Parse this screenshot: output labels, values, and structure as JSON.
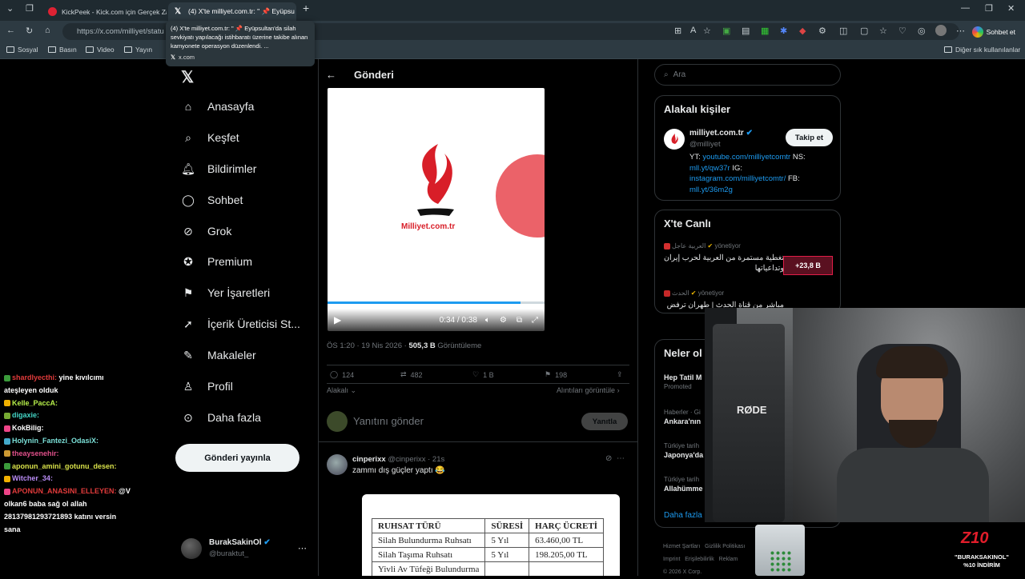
{
  "browser": {
    "tabs": [
      {
        "title": "KickPeek - Kick.com için Gerçek Za"
      },
      {
        "title": "(4) X'te milliyet.com.tr: \" 📌 Eyüpsu"
      }
    ],
    "url": "https://x.com/milliyet/statu",
    "sohbet_label": "Sohbet et",
    "bookmarks": [
      "Sosyal",
      "Basın",
      "Video",
      "Yayın"
    ],
    "other_bookmarks": "Diğer sık kullanılanlar"
  },
  "tooltip": {
    "text": "(4) X'te milliyet.com.tr: \" 📌 Eyüpsultan'da silah sevkiyatı yapılacağı istihbaratı üzerine takibe alınan kamyonete operasyon düzenlendi. ...",
    "domain": "x.com"
  },
  "chat": [
    {
      "user": "shardlyecthi:",
      "msg": "yine kıvılcımı",
      "color": "#e23b3b"
    },
    {
      "user": "",
      "msg": "ateşleyen olduk",
      "color": "#ffffff"
    },
    {
      "user": "Kelle_PaccA:",
      "msg": "",
      "color": "#b7f04a"
    },
    {
      "user": "digaxie:",
      "msg": "",
      "color": "#44d6c6"
    },
    {
      "user": "KokBilig:",
      "msg": "",
      "color": "#ffffff"
    },
    {
      "user": "Holynin_Fantezi_OdasiX:",
      "msg": "",
      "color": "#7be0d8"
    },
    {
      "user": "theaysenehir:",
      "msg": "",
      "color": "#e0508a"
    },
    {
      "user": "aponun_amini_gotunu_desen:",
      "msg": "",
      "color": "#d9e24a"
    },
    {
      "user": "",
      "msg": "",
      "color": "#ffffff"
    },
    {
      "user": "Witcher_34:",
      "msg": "",
      "color": "#b98cf5"
    },
    {
      "user": "",
      "msg": "",
      "color": "#ffffff"
    },
    {
      "user": "APONUN_ANASINI_ELLEYEN:",
      "msg": "@V",
      "color": "#e23b3b"
    },
    {
      "user": "",
      "msg": "olkan6 baba sağ ol allah",
      "color": "#ffffff"
    },
    {
      "user": "",
      "msg": "2813798129372189​3 katını versin",
      "color": "#ffffff"
    },
    {
      "user": "",
      "msg": "sana",
      "color": "#ffffff"
    }
  ],
  "nav": {
    "items": [
      "Anasayfa",
      "Keşfet",
      "Bildirimler",
      "Sohbet",
      "Grok",
      "Premium",
      "Yer İşaretleri",
      "İçerik Üreticisi St...",
      "Makaleler",
      "Profil",
      "Daha fazla"
    ],
    "post_button": "Gönderi yayınla",
    "account_name": "BurakSakinOl",
    "account_handle": "@buraktut_"
  },
  "post": {
    "header": "Gönderi",
    "video_logo_text": "Milliyet.com.tr",
    "video_time": "0:34 / 0:38",
    "video_progress": 0.89,
    "timestamp": "ÖS 1:20 · 19 Nis 2026 · ",
    "views": "505,3 B",
    "views_label": "Görüntüleme",
    "replies": "124",
    "reposts": "482",
    "likes": "1 B",
    "bookmarks": "198",
    "related_label": "Alakalı",
    "quotes_label": "Alıntıları görüntüle",
    "reply_placeholder": "Yanıtını gönder",
    "reply_button": "Yanıtla"
  },
  "reply_tweet": {
    "name": "cinperixx",
    "handle": "@cinperixx · 21s",
    "text": "zammı dış güçler yaptı 😂",
    "table_headers": [
      "RUHSAT TÜRÜ",
      "SÜRESİ",
      "HARÇ ÜCRETİ"
    ],
    "table_rows": [
      [
        "Silah Bulundurma Ruhsatı",
        "5 Yıl",
        "63.460,00 TL"
      ],
      [
        "Silah Taşıma Ruhsatı",
        "5 Yıl",
        "198.205,00 TL"
      ],
      [
        "Yivli Av Tüfeği Bulundurma",
        "",
        ""
      ]
    ]
  },
  "right": {
    "search_placeholder": "Ara",
    "related_title": "Alakalı kişiler",
    "related_name": "milliyet.com.tr",
    "related_handle": "@milliyet",
    "follow_button": "Takip et",
    "bio_yt_label": "YT:",
    "bio_yt": "youtube.com/milliyetcomtr",
    "bio_ns_label": "NS:",
    "bio_ns": "mll.yt/qw37r",
    "bio_ig_label": "IG:",
    "bio_ig": "instagram.com/milliyetcomtr/",
    "bio_fb_label": "FB:",
    "bio_fb": "mll.yt/36m2g",
    "live_title": "X'te Canlı",
    "live_items": [
      {
        "source": "العربية عاجل",
        "status": "yönetiyor",
        "text": "تغطية مستمرة من العربية لحرب إيران وتداعياتها",
        "badge": "+23,8 B"
      },
      {
        "source": "الحدث",
        "status": "yönetiyor",
        "text": "مباشر من قناة الحدث | طهران ترفض الجولة الثانية من",
        "badge": ""
      }
    ],
    "trends_title": "Neler ol",
    "trends": [
      {
        "label": "",
        "title": "Hep Tatil M",
        "sub": "Promoted"
      },
      {
        "label": "Haberler · Gi",
        "title": "Ankara'nın",
        "sub": ""
      },
      {
        "label": "Türkiye tarih",
        "title": "Japonya'da",
        "sub": ""
      },
      {
        "label": "Türkiye tarih",
        "title": "Allahümme",
        "sub": ""
      }
    ],
    "show_more": "Daha fazla",
    "footer": [
      "Hizmet Şartları",
      "Gizlilik Politikası",
      "Imprint",
      "Erişilebilirlik",
      "Reklam",
      "© 2026 X Corp."
    ]
  },
  "overlay": {
    "mic_brand": "RØDE",
    "promo_code": "\"BURAKSAKINOL\"",
    "promo_discount": "%10 İNDİRİM",
    "promo_logo": "Z10"
  },
  "colors": {
    "accent": "#1d9bf0",
    "bg": "#000000",
    "muted": "#71767b",
    "border": "#2f3336",
    "milliyet_red": "#d81e28"
  }
}
